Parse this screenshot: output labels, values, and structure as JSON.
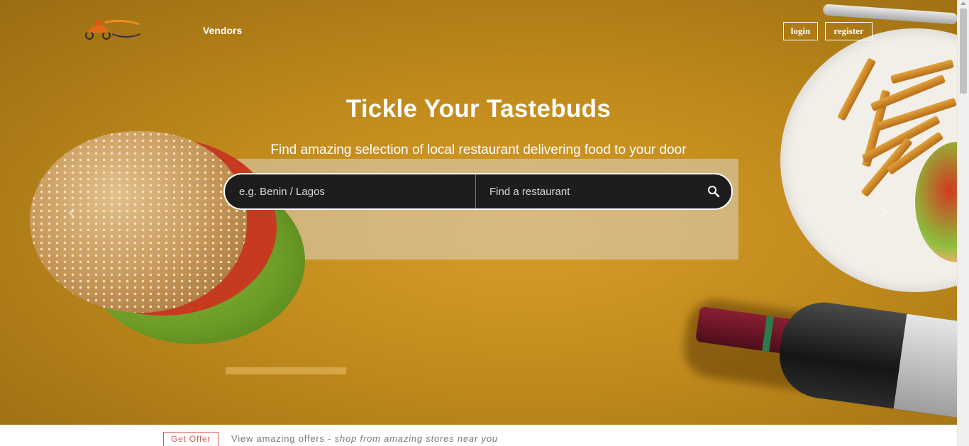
{
  "nav": {
    "vendors_label": "Vendors"
  },
  "auth": {
    "login_label": "login",
    "register_label": "register"
  },
  "hero": {
    "title": "Tickle Your Tastebuds",
    "subtitle": "Find amazing selection of local restaurant delivering food to your door"
  },
  "search": {
    "location_placeholder": "e.g. Benin / Lagos",
    "restaurant_placeholder": "Find a restaurant",
    "button_icon": "search-icon"
  },
  "carousel": {
    "prev_icon": "chevron-left-icon",
    "next_icon": "chevron-right-icon"
  },
  "offer": {
    "button_label": "Get Offer",
    "text": "View amazing offers - ",
    "text_italic": "shop from amazing stores near you"
  },
  "colors": {
    "hero_bg": "#c08a1c",
    "offer_accent": "#d9534f",
    "search_bg": "#1d1d1d"
  }
}
